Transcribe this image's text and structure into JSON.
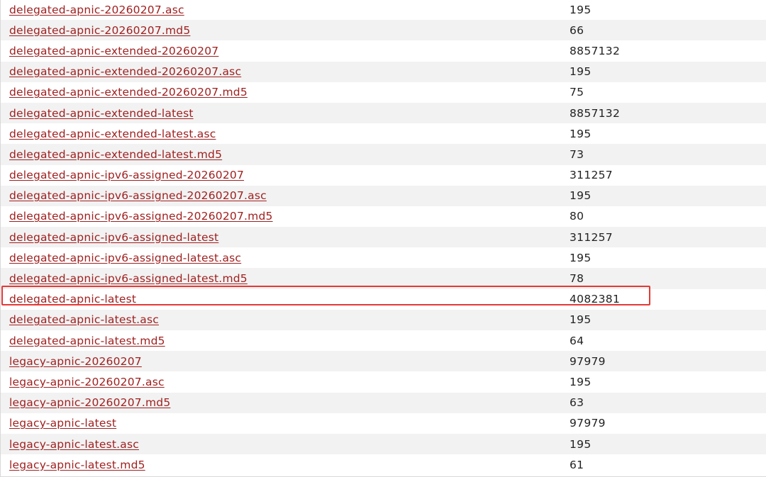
{
  "listing": {
    "files": [
      {
        "name": "delegated-apnic-20260207.asc",
        "size": "195"
      },
      {
        "name": "delegated-apnic-20260207.md5",
        "size": "66"
      },
      {
        "name": "delegated-apnic-extended-20260207",
        "size": "8857132"
      },
      {
        "name": "delegated-apnic-extended-20260207.asc",
        "size": "195"
      },
      {
        "name": "delegated-apnic-extended-20260207.md5",
        "size": "75"
      },
      {
        "name": "delegated-apnic-extended-latest",
        "size": "8857132"
      },
      {
        "name": "delegated-apnic-extended-latest.asc",
        "size": "195"
      },
      {
        "name": "delegated-apnic-extended-latest.md5",
        "size": "73"
      },
      {
        "name": "delegated-apnic-ipv6-assigned-20260207",
        "size": "311257"
      },
      {
        "name": "delegated-apnic-ipv6-assigned-20260207.asc",
        "size": "195"
      },
      {
        "name": "delegated-apnic-ipv6-assigned-20260207.md5",
        "size": "80"
      },
      {
        "name": "delegated-apnic-ipv6-assigned-latest",
        "size": "311257"
      },
      {
        "name": "delegated-apnic-ipv6-assigned-latest.asc",
        "size": "195"
      },
      {
        "name": "delegated-apnic-ipv6-assigned-latest.md5",
        "size": "78"
      },
      {
        "name": "delegated-apnic-latest",
        "size": "4082381"
      },
      {
        "name": "delegated-apnic-latest.asc",
        "size": "195"
      },
      {
        "name": "delegated-apnic-latest.md5",
        "size": "64"
      },
      {
        "name": "legacy-apnic-20260207",
        "size": "97979"
      },
      {
        "name": "legacy-apnic-20260207.asc",
        "size": "195"
      },
      {
        "name": "legacy-apnic-20260207.md5",
        "size": "63"
      },
      {
        "name": "legacy-apnic-latest",
        "size": "97979"
      },
      {
        "name": "legacy-apnic-latest.asc",
        "size": "195"
      },
      {
        "name": "legacy-apnic-latest.md5",
        "size": "61"
      }
    ]
  },
  "colors": {
    "link": "#a02020",
    "alt_row": "#f2f2f2",
    "highlight": "#e53935"
  }
}
